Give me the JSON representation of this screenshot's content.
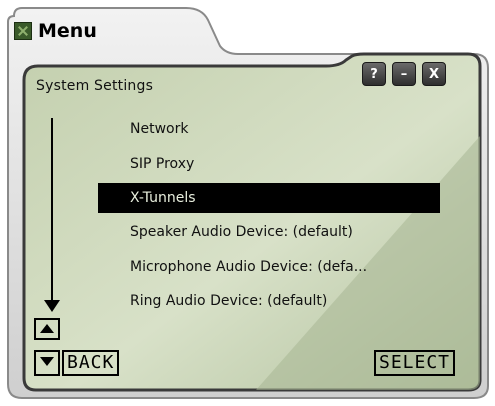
{
  "app": {
    "title": "Menu",
    "icon": "app-icon"
  },
  "screen": {
    "title": "System Settings",
    "bg_light": "#cfd9bc",
    "bg_dark": "#a9b898"
  },
  "window_buttons": {
    "help": "?",
    "minimize": "–",
    "close": "X"
  },
  "menu": {
    "items": [
      {
        "label": "Network"
      },
      {
        "label": "SIP Proxy"
      },
      {
        "label": "X-Tunnels"
      },
      {
        "label": "Speaker Audio Device: (default)"
      },
      {
        "label": "Microphone Audio Device: (defa..."
      },
      {
        "label": "Ring Audio Device: (default)"
      }
    ],
    "selected_index": 2
  },
  "softkeys": {
    "back": "BACK",
    "select": "SELECT"
  }
}
